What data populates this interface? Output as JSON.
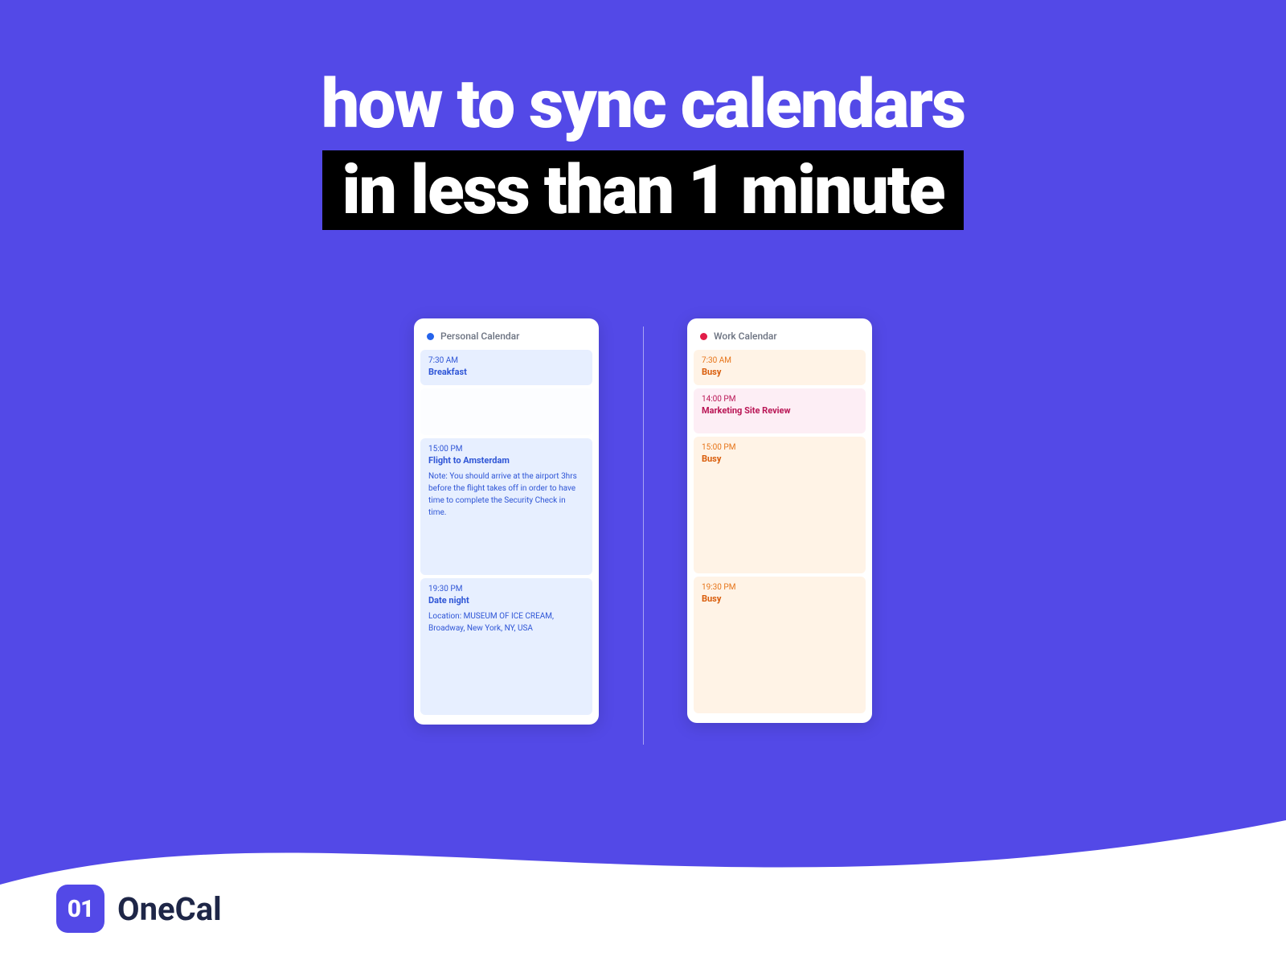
{
  "headline": {
    "line1": "how to sync calendars",
    "line2": "in less than 1 minute"
  },
  "personal_calendar": {
    "title": "Personal Calendar",
    "events": [
      {
        "time": "7:30 AM",
        "title": "Breakfast"
      },
      {
        "time": "15:00 PM",
        "title": "Flight to Amsterdam",
        "note": "Note: You should arrive at the airport 3hrs before the flight takes off in order to have time to complete the Security Check in time."
      },
      {
        "time": "19:30 PM",
        "title": "Date night",
        "note": "Location: MUSEUM OF ICE CREAM, Broadway, New York, NY, USA"
      }
    ]
  },
  "work_calendar": {
    "title": "Work Calendar",
    "events": [
      {
        "time": "7:30 AM",
        "title": "Busy",
        "style": "orange"
      },
      {
        "time": "14:00 PM",
        "title": "Marketing Site Review",
        "style": "pink"
      },
      {
        "time": "15:00 PM",
        "title": "Busy",
        "style": "orange"
      },
      {
        "time": "19:30 PM",
        "title": "Busy",
        "style": "orange"
      }
    ]
  },
  "brand": {
    "name": "OneCal",
    "icon_text": "01"
  }
}
